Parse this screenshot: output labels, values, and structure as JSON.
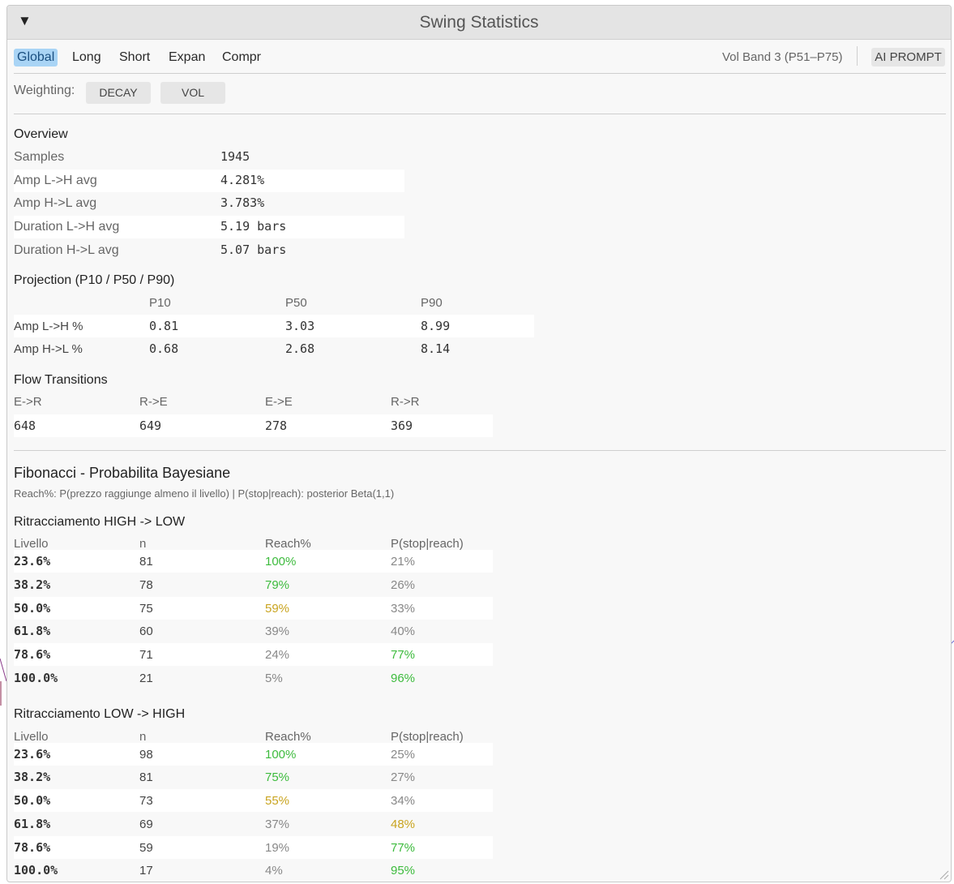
{
  "window": {
    "title": "Swing Statistics",
    "collapse_icon": "triangle-down-icon"
  },
  "tabs": [
    {
      "label": "Global",
      "active": true
    },
    {
      "label": "Long",
      "active": false
    },
    {
      "label": "Short",
      "active": false
    },
    {
      "label": "Expan",
      "active": false
    },
    {
      "label": "Compr",
      "active": false
    }
  ],
  "vol_band": "Vol Band 3  (P51–P75)",
  "ai_prompt_label": "AI PROMPT",
  "weighting": {
    "label": "Weighting:",
    "buttons": [
      "DECAY",
      "VOL"
    ]
  },
  "overview": {
    "heading": "Overview",
    "rows": [
      {
        "label": "Samples",
        "value": "1945"
      },
      {
        "label": "Amp  L->H  avg",
        "value": "4.281%"
      },
      {
        "label": "Amp  H->L  avg",
        "value": "3.783%"
      },
      {
        "label": "Duration  L->H  avg",
        "value": "5.19 bars"
      },
      {
        "label": "Duration  H->L  avg",
        "value": "5.07 bars"
      }
    ]
  },
  "projection": {
    "heading": "Projection  (P10 / P50 / P90)",
    "columns": [
      "P10",
      "P50",
      "P90"
    ],
    "rows": [
      {
        "label": "Amp L->H %",
        "values": [
          "0.81",
          "3.03",
          "8.99"
        ]
      },
      {
        "label": "Amp H->L %",
        "values": [
          "0.68",
          "2.68",
          "8.14"
        ]
      }
    ]
  },
  "flow": {
    "heading": "Flow Transitions",
    "columns": [
      "E->R",
      "R->E",
      "E->E",
      "R->R"
    ],
    "values": [
      "648",
      "649",
      "278",
      "369"
    ]
  },
  "fibonacci": {
    "heading": "Fibonacci  -  Probabilita Bayesiane",
    "subtitle": "Reach%: P(prezzo raggiunge almeno il livello)   |   P(stop|reach): posterior Beta(1,1)",
    "columns": [
      "Livello",
      "n",
      "Reach%",
      "P(stop|reach)"
    ],
    "colors": {
      "green": "#3dbb3d",
      "yellow": "#c9a41f",
      "gray": "#888888"
    },
    "sections": [
      {
        "heading": "Ritracciamento  HIGH -> LOW",
        "rows": [
          {
            "level": "23.6%",
            "n": "81",
            "reach": "100%",
            "reach_color": "green",
            "stop": "21%",
            "stop_color": "gray"
          },
          {
            "level": "38.2%",
            "n": "78",
            "reach": "79%",
            "reach_color": "green",
            "stop": "26%",
            "stop_color": "gray"
          },
          {
            "level": "50.0%",
            "n": "75",
            "reach": "59%",
            "reach_color": "yellow",
            "stop": "33%",
            "stop_color": "gray"
          },
          {
            "level": "61.8%",
            "n": "60",
            "reach": "39%",
            "reach_color": "gray",
            "stop": "40%",
            "stop_color": "gray"
          },
          {
            "level": "78.6%",
            "n": "71",
            "reach": "24%",
            "reach_color": "gray",
            "stop": "77%",
            "stop_color": "green"
          },
          {
            "level": "100.0%",
            "n": "21",
            "reach": "5%",
            "reach_color": "gray",
            "stop": "96%",
            "stop_color": "green"
          }
        ]
      },
      {
        "heading": "Ritracciamento  LOW -> HIGH",
        "rows": [
          {
            "level": "23.6%",
            "n": "98",
            "reach": "100%",
            "reach_color": "green",
            "stop": "25%",
            "stop_color": "gray"
          },
          {
            "level": "38.2%",
            "n": "81",
            "reach": "75%",
            "reach_color": "green",
            "stop": "27%",
            "stop_color": "gray"
          },
          {
            "level": "50.0%",
            "n": "73",
            "reach": "55%",
            "reach_color": "yellow",
            "stop": "34%",
            "stop_color": "gray"
          },
          {
            "level": "61.8%",
            "n": "69",
            "reach": "37%",
            "reach_color": "gray",
            "stop": "48%",
            "stop_color": "yellow"
          },
          {
            "level": "78.6%",
            "n": "59",
            "reach": "19%",
            "reach_color": "gray",
            "stop": "77%",
            "stop_color": "green"
          },
          {
            "level": "100.0%",
            "n": "17",
            "reach": "4%",
            "reach_color": "gray",
            "stop": "95%",
            "stop_color": "green"
          }
        ]
      }
    ]
  }
}
